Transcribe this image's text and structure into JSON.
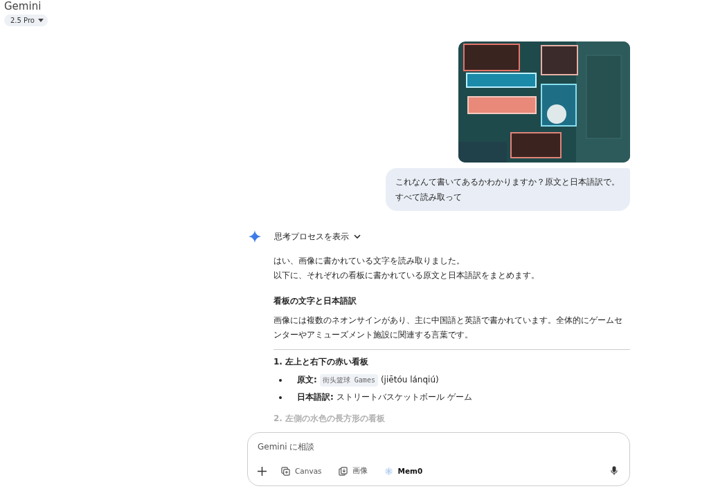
{
  "header": {
    "title": "Gemini",
    "model": "2.5 Pro"
  },
  "user_message": {
    "text": "これなんて書いてあるかわかりますか？原文と日本語訳で。すべて読み取って"
  },
  "response": {
    "thinking_label": "思考プロセスを表示",
    "intro": [
      "はい、画像に書かれている文字を読み取りました。",
      "以下に、それぞれの看板に書かれている原文と日本語訳をまとめます。"
    ],
    "heading": "看板の文字と日本語訳",
    "paragraph": "画像には複数のネオンサインがあり、主に中国語と英語で書かれています。全体的にゲームセンターやアミューズメント施設に関連する言葉です。",
    "sections": [
      {
        "heading": "1. 左上と右下の赤い看板",
        "faded": false,
        "bullets": [
          {
            "label": "原文:",
            "code": "街头篮球 Games",
            "text": "(jiētóu lánqiú)"
          },
          {
            "label": "日本語訳:",
            "text": "ストリートバスケットボール ゲーム"
          }
        ]
      },
      {
        "heading": "2. 左側の水色の長方形の看板",
        "faded": true
      }
    ]
  },
  "composer": {
    "placeholder": "Gemini に相談",
    "tools": [
      {
        "kind": "canvas",
        "label": "Canvas"
      },
      {
        "label": "画像"
      },
      {
        "kind": "mem0",
        "label": "Mem0"
      }
    ]
  }
}
